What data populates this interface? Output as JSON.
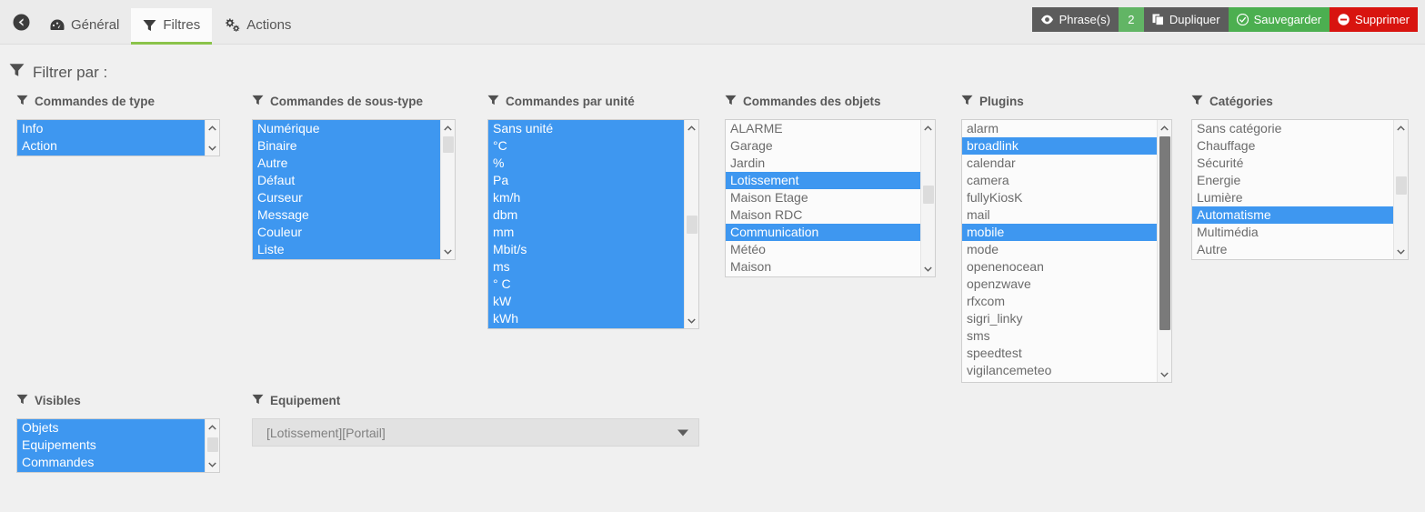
{
  "topbar": {
    "back_icon": "back-arrow-icon",
    "tabs": [
      {
        "label": "Général",
        "icon": "dashboard-icon",
        "active": false
      },
      {
        "label": "Filtres",
        "icon": "funnel-icon",
        "active": true
      },
      {
        "label": "Actions",
        "icon": "gears-icon",
        "active": false
      }
    ],
    "actions": [
      {
        "label": "Phrase(s)",
        "icon": "eye-icon",
        "style": "grey",
        "badge": "2"
      },
      {
        "label": "Dupliquer",
        "icon": "copy-icon",
        "style": "grey"
      },
      {
        "label": "Sauvegarder",
        "icon": "check-circle-icon",
        "style": "green"
      },
      {
        "label": "Supprimer",
        "icon": "minus-circle-icon",
        "style": "red"
      }
    ]
  },
  "colors": {
    "accent_selection": "#3e97f0",
    "save_green": "#4caf50",
    "delete_red": "#d8140f",
    "badge_green": "#62b565",
    "tab_underline": "#8bc34a",
    "page_bg": "#f0f0f0"
  },
  "filter_header": "Filtrer par :",
  "columns": {
    "type": {
      "title": "Commandes de type",
      "items": [
        {
          "label": "Info",
          "selected": true
        },
        {
          "label": "Action",
          "selected": true
        }
      ]
    },
    "subtype": {
      "title": "Commandes de sous-type",
      "items": [
        {
          "label": "Numérique",
          "selected": true
        },
        {
          "label": "Binaire",
          "selected": true
        },
        {
          "label": "Autre",
          "selected": true
        },
        {
          "label": "Défaut",
          "selected": true
        },
        {
          "label": "Curseur",
          "selected": true
        },
        {
          "label": "Message",
          "selected": true
        },
        {
          "label": "Couleur",
          "selected": true
        },
        {
          "label": "Liste",
          "selected": true
        }
      ]
    },
    "unit": {
      "title": "Commandes par unité",
      "items": [
        {
          "label": "Sans unité",
          "selected": true
        },
        {
          "label": "°C",
          "selected": true
        },
        {
          "label": "%",
          "selected": true
        },
        {
          "label": "Pa",
          "selected": true
        },
        {
          "label": "km/h",
          "selected": true
        },
        {
          "label": "dbm",
          "selected": true
        },
        {
          "label": "mm",
          "selected": true
        },
        {
          "label": "Mbit/s",
          "selected": true
        },
        {
          "label": "ms",
          "selected": true
        },
        {
          "label": "° C",
          "selected": true
        },
        {
          "label": "kW",
          "selected": true
        },
        {
          "label": "kWh",
          "selected": true
        }
      ]
    },
    "objects": {
      "title": "Commandes des objets",
      "items": [
        {
          "label": "ALARME",
          "selected": false
        },
        {
          "label": "Garage",
          "selected": false
        },
        {
          "label": "Jardin",
          "selected": false
        },
        {
          "label": "Lotissement",
          "selected": true
        },
        {
          "label": "Maison Etage",
          "selected": false
        },
        {
          "label": "Maison RDC",
          "selected": false
        },
        {
          "label": "Communication",
          "selected": true
        },
        {
          "label": "Météo",
          "selected": false
        },
        {
          "label": "Maison",
          "selected": false
        }
      ]
    },
    "plugins": {
      "title": "Plugins",
      "items": [
        {
          "label": "alarm",
          "selected": false
        },
        {
          "label": "broadlink",
          "selected": true
        },
        {
          "label": "calendar",
          "selected": false
        },
        {
          "label": "camera",
          "selected": false
        },
        {
          "label": "fullyKiosK",
          "selected": false
        },
        {
          "label": "mail",
          "selected": false
        },
        {
          "label": "mobile",
          "selected": true
        },
        {
          "label": "mode",
          "selected": false
        },
        {
          "label": "openenocean",
          "selected": false
        },
        {
          "label": "openzwave",
          "selected": false
        },
        {
          "label": "rfxcom",
          "selected": false
        },
        {
          "label": "sigri_linky",
          "selected": false
        },
        {
          "label": "sms",
          "selected": false
        },
        {
          "label": "speedtest",
          "selected": false
        },
        {
          "label": "vigilancemeteo",
          "selected": false
        }
      ]
    },
    "categories": {
      "title": "Catégories",
      "items": [
        {
          "label": "Sans catégorie",
          "selected": false
        },
        {
          "label": "Chauffage",
          "selected": false
        },
        {
          "label": "Sécurité",
          "selected": false
        },
        {
          "label": "Energie",
          "selected": false
        },
        {
          "label": "Lumière",
          "selected": false
        },
        {
          "label": "Automatisme",
          "selected": true
        },
        {
          "label": "Multimédia",
          "selected": false
        },
        {
          "label": "Autre",
          "selected": false
        }
      ]
    },
    "visibles": {
      "title": "Visibles",
      "items": [
        {
          "label": "Objets",
          "selected": true
        },
        {
          "label": "Equipements",
          "selected": true
        },
        {
          "label": "Commandes",
          "selected": true
        }
      ]
    },
    "equipement": {
      "title": "Equipement",
      "value": "[Lotissement][Portail]"
    }
  }
}
